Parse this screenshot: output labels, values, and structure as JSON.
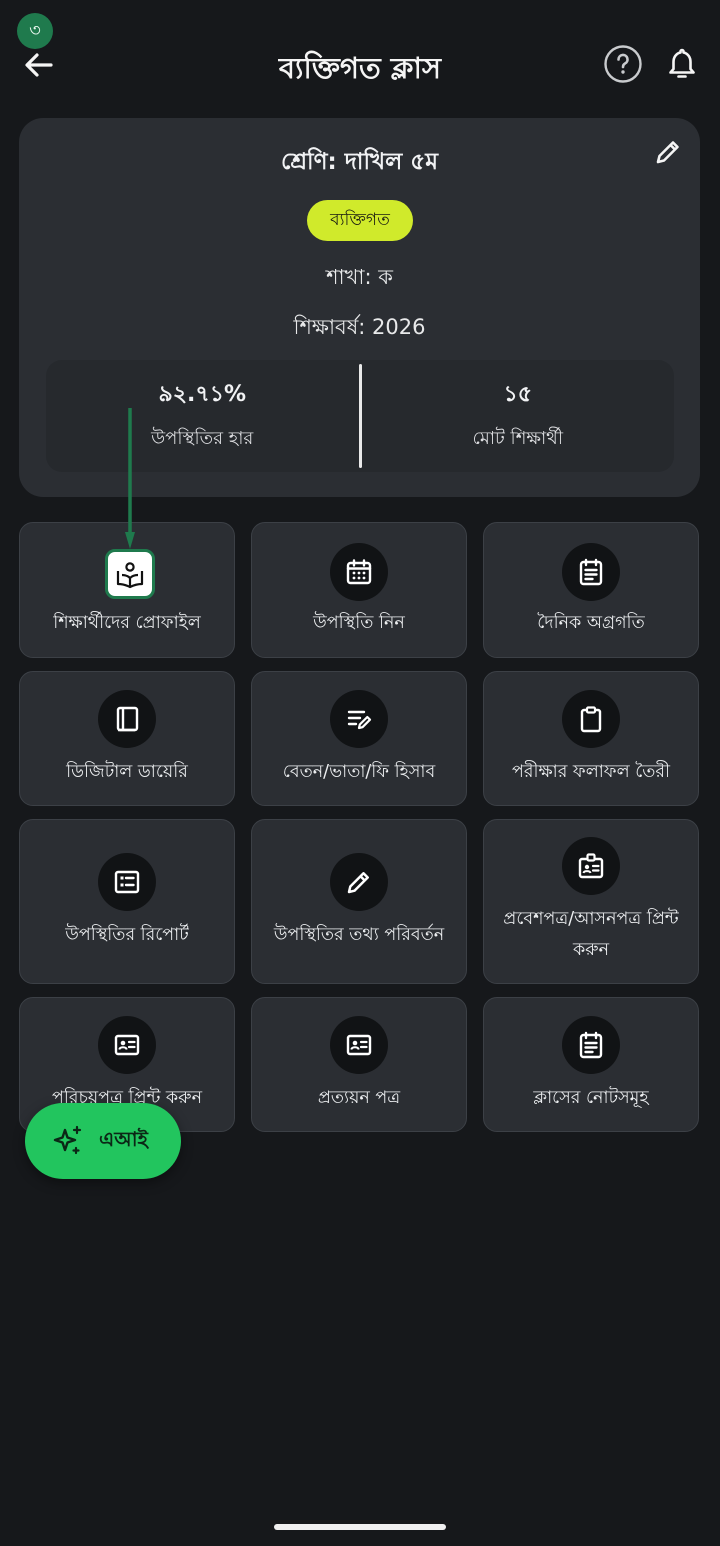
{
  "step_badge": "৩",
  "header": {
    "title": "ব্যক্তিগত ক্লাস"
  },
  "class_info": {
    "name": "শ্রেণি: দাখিল ৫ম",
    "type_badge": "ব্যক্তিগত",
    "section": "শাখা: ক",
    "academic_year": "শিক্ষাবর্ষ: 2026",
    "stats": [
      {
        "value": "৯২.৭১%",
        "label": "উপস্থিতির হার"
      },
      {
        "value": "১৫",
        "label": "মোট শিক্ষার্থী"
      }
    ]
  },
  "menu": [
    {
      "label": "শিক্ষার্থীদের প্রোফাইল",
      "icon": "student-profile-icon"
    },
    {
      "label": "উপস্থিতি নিন",
      "icon": "calendar-icon"
    },
    {
      "label": "দৈনিক অগ্রগতি",
      "icon": "notes-icon"
    },
    {
      "label": "ডিজিটাল ডায়েরি",
      "icon": "book-icon"
    },
    {
      "label": "বেতন/ভাতা/ফি হিসাব",
      "icon": "edit-note-icon"
    },
    {
      "label": "পরীক্ষার ফলাফল তৈরী",
      "icon": "clipboard-icon"
    },
    {
      "label": "উপস্থিতির রিপোর্ট",
      "icon": "list-icon"
    },
    {
      "label": "উপস্থিতির তথ্য পরিবর্তন",
      "icon": "pencil-icon"
    },
    {
      "label": "প্রবেশপত্র/আসনপত্র প্রিন্ট করুন",
      "icon": "badge-icon"
    },
    {
      "label": "পরিচয়পত্র প্রিন্ট করুন",
      "icon": "id-card-icon"
    },
    {
      "label": "প্রত্যয়ন পত্র",
      "icon": "id-card-icon"
    },
    {
      "label": "ক্লাসের নোটসমূহ",
      "icon": "notes-icon"
    }
  ],
  "fab": {
    "label": "এআই"
  },
  "colors": {
    "accent": "#22c55e",
    "badge": "#d0ea2b",
    "annotation": "#1f7a4d"
  }
}
